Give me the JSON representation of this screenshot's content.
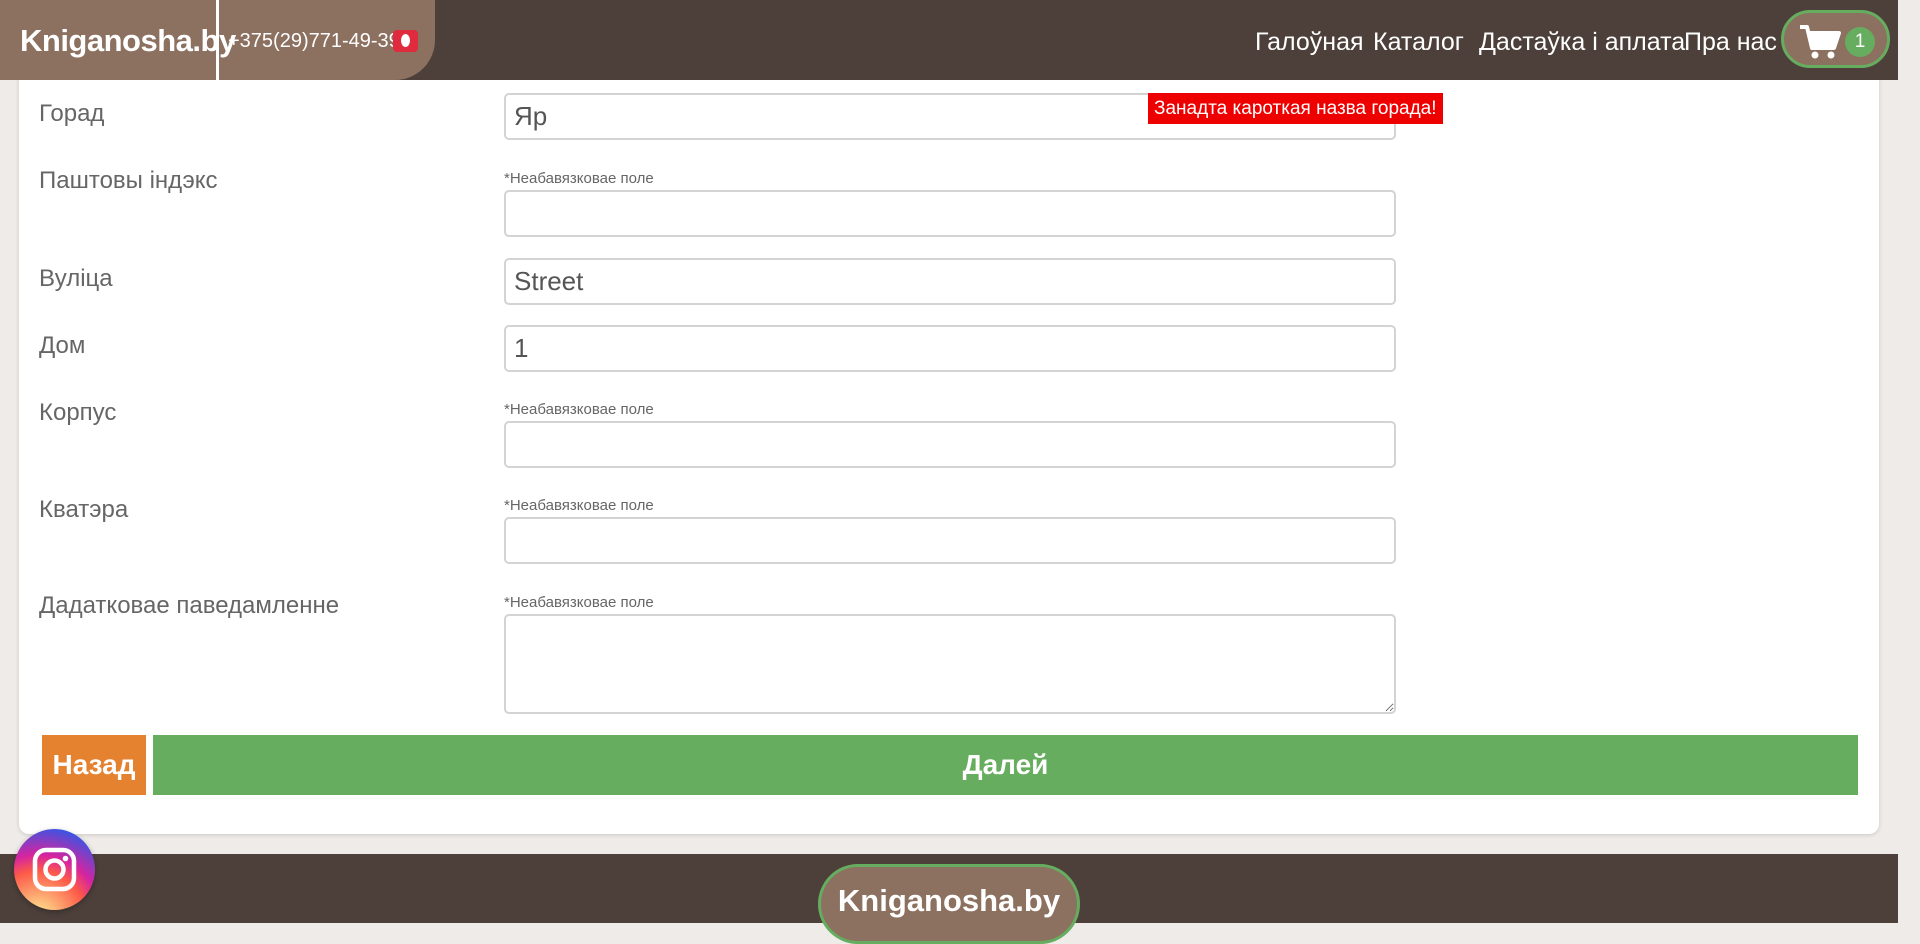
{
  "header": {
    "logo": "Kniganosha.by",
    "phone": "+375(29)771-49-39",
    "nav": [
      {
        "label": "Галоўная"
      },
      {
        "label": "Каталог"
      },
      {
        "label": "Дастаўка і аплата"
      },
      {
        "label": "Пра нас"
      }
    ],
    "cart_count": "1"
  },
  "form": {
    "city": {
      "label": "Горад",
      "value": "Яр",
      "error": "Занадта кароткая назва горада!"
    },
    "postal": {
      "label": "Паштовы індэкс",
      "hint": "*Неабавязковае поле",
      "value": ""
    },
    "street": {
      "label": "Вуліца",
      "value": "Street"
    },
    "house": {
      "label": "Дом",
      "value": "1"
    },
    "building": {
      "label": "Корпус",
      "hint": "*Неабавязковае поле",
      "value": ""
    },
    "apartment": {
      "label": "Кватэра",
      "hint": "*Неабавязковае поле",
      "value": ""
    },
    "message": {
      "label": "Дадатковае паведамленне",
      "hint": "*Неабавязковае поле",
      "value": ""
    }
  },
  "buttons": {
    "back": "Назад",
    "next": "Далей"
  },
  "footer": {
    "logo": "Kniganosha.by"
  },
  "colors": {
    "header_bg": "#4d403b",
    "brand_brown": "#8c7060",
    "accent_green": "#66ad5f",
    "back_orange": "#e5822f",
    "error_red": "#ee0000"
  },
  "icons": [
    "viber-icon",
    "cart-icon",
    "instagram-icon"
  ]
}
